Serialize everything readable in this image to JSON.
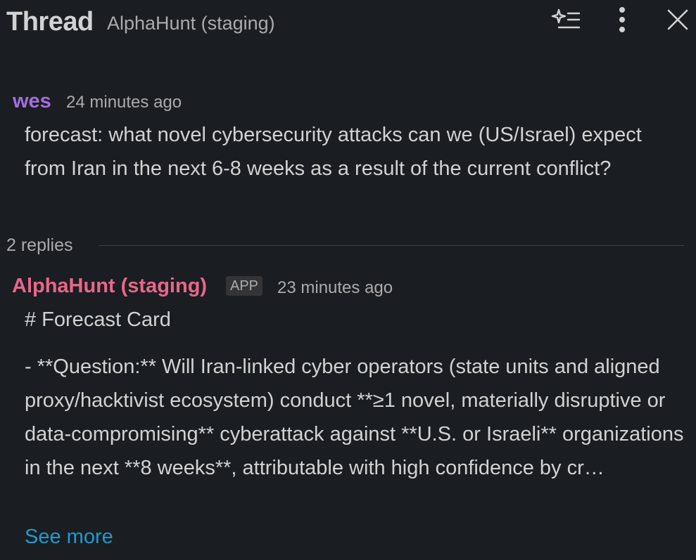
{
  "header": {
    "title": "Thread",
    "channel": "AlphaHunt (staging)",
    "icons": [
      "ai-summary-icon",
      "more-vertical-icon",
      "close-icon"
    ]
  },
  "message1": {
    "author": "wes",
    "time": "24 minutes ago",
    "body": "forecast: what novel cybersecurity attacks can we (US/Israel) expect from Iran in the next 6-8 weeks as a result of the current conflict?"
  },
  "replies": {
    "count_label": "2 replies"
  },
  "message2": {
    "author": "AlphaHunt (staging)",
    "badge": "APP",
    "time": "23 minutes ago",
    "heading": "# Forecast Card",
    "body": "- **Question:** Will Iran-linked cyber operators (state units and aligned proxy/hacktivist ecosystem) conduct **≥1 novel, materially disruptive or data-compromising** cyberattack against **U.S. or Israeli** organizations in the next **8 weeks**, attributable with high confidence by cr…",
    "see_more": "See more"
  },
  "colors": {
    "background": "#1a1d21",
    "user_name": "#a36ee0",
    "app_name": "#e8678a",
    "link": "#1d9bd1"
  }
}
